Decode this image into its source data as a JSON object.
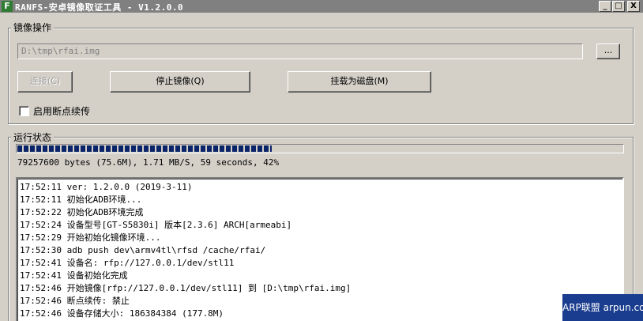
{
  "window": {
    "icon_letter": "F",
    "title": "RANFS-安卓镜像取证工具 - V1.2.0.0",
    "minimize": "_",
    "maximize": "□",
    "close": "X"
  },
  "image_group": {
    "label": "镜像操作",
    "path_value": "D:\\tmp\\rfai.img",
    "browse_label": "...",
    "connect_label": "连接(C)",
    "stop_label": "停止镜像(Q)",
    "mount_label": "挂载为磁盘(M)",
    "resume_checkbox_label": "启用断点续传",
    "resume_checked": false
  },
  "status_group": {
    "label": "运行状态",
    "progress_fraction": 0.42,
    "status_text": "79257600 bytes (75.6M), 1.71 MB/S, 59 seconds, 42%",
    "log_lines": [
      "17:52:11 ver: 1.2.0.0 (2019-3-11)",
      "17:52:11 初始化ADB环境...",
      "17:52:22 初始化ADB环境完成",
      "17:52:24 设备型号[GT-S5830i] 版本[2.3.6] ARCH[armeabi]",
      "17:52:29 开始初始化镜像环境...",
      "17:52:30 adb push dev\\armv4tl\\rfsd /cache/rfai/",
      "17:52:41 设备名: rfp://127.0.0.1/dev/stl11",
      "17:52:41 设备初始化完成",
      "17:52:46 开始镜像[rfp://127.0.0.1/dev/stl11] 到 [D:\\tmp\\rfai.img]",
      "17:52:46 断点续传: 禁止",
      "17:52:46 设备存储大小: 186384384 (177.8M)"
    ]
  },
  "watermark": {
    "text": "ARP联盟 arpun.com"
  },
  "colors": {
    "titlebar": "#808080",
    "progress": "#0a246a",
    "face": "#d4d0c8"
  }
}
